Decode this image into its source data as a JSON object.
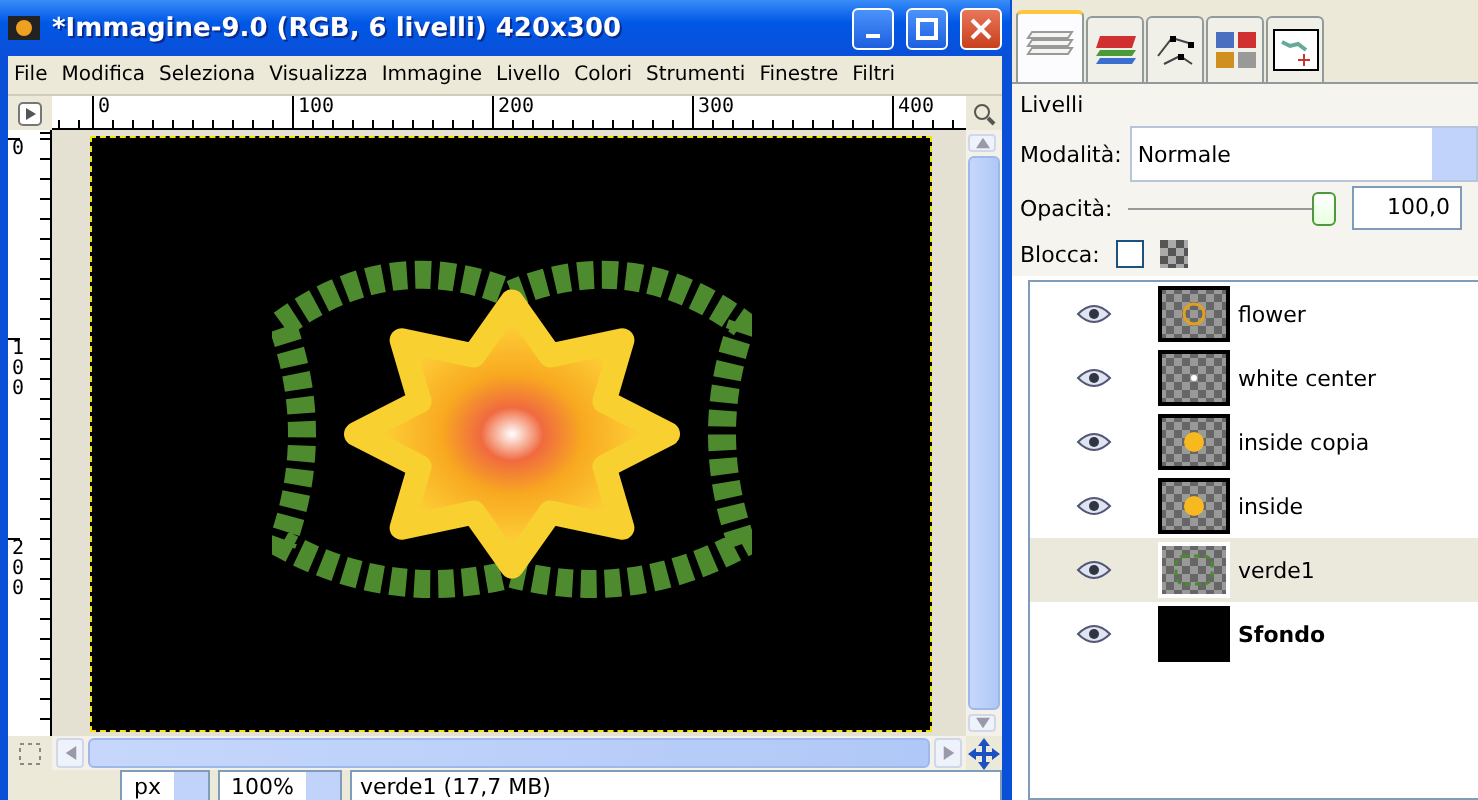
{
  "window": {
    "title": "*Immagine-9.0 (RGB, 6 livelli) 420x300"
  },
  "menu": [
    "File",
    "Modifica",
    "Seleziona",
    "Visualizza",
    "Immagine",
    "Livello",
    "Colori",
    "Strumenti",
    "Finestre",
    "Filtri"
  ],
  "ruler": {
    "horizontal": [
      "0",
      "100",
      "200",
      "300",
      "400"
    ],
    "vertical": [
      "0",
      "100",
      "200"
    ]
  },
  "status": {
    "unit": "px",
    "zoom": "100%",
    "info": "verde1 (17,7 MB)"
  },
  "dock": {
    "tabs": [
      {
        "kind": "layers",
        "selected": true
      },
      {
        "kind": "channels",
        "selected": false
      },
      {
        "kind": "paths",
        "selected": false
      },
      {
        "kind": "colormap",
        "selected": false
      },
      {
        "kind": "navigation",
        "selected": false
      }
    ],
    "title": "Livelli",
    "mode": {
      "label": "Modalità:",
      "value": "Normale"
    },
    "opacity": {
      "label": "Opacità:",
      "level": 1.0,
      "value": "100,0"
    },
    "lock": {
      "label": "Blocca:",
      "checked": false
    },
    "layers": [
      {
        "name": "flower",
        "kind": "ring",
        "visible": true,
        "selected": false
      },
      {
        "name": "white center",
        "kind": "spark",
        "visible": true,
        "selected": false
      },
      {
        "name": "inside copia",
        "kind": "blob",
        "visible": true,
        "selected": false
      },
      {
        "name": "inside",
        "kind": "blob",
        "visible": true,
        "selected": false
      },
      {
        "name": "verde1",
        "kind": "leaves",
        "visible": true,
        "selected": true
      },
      {
        "name": "Sfondo",
        "kind": "background",
        "visible": true,
        "selected": false
      }
    ]
  }
}
